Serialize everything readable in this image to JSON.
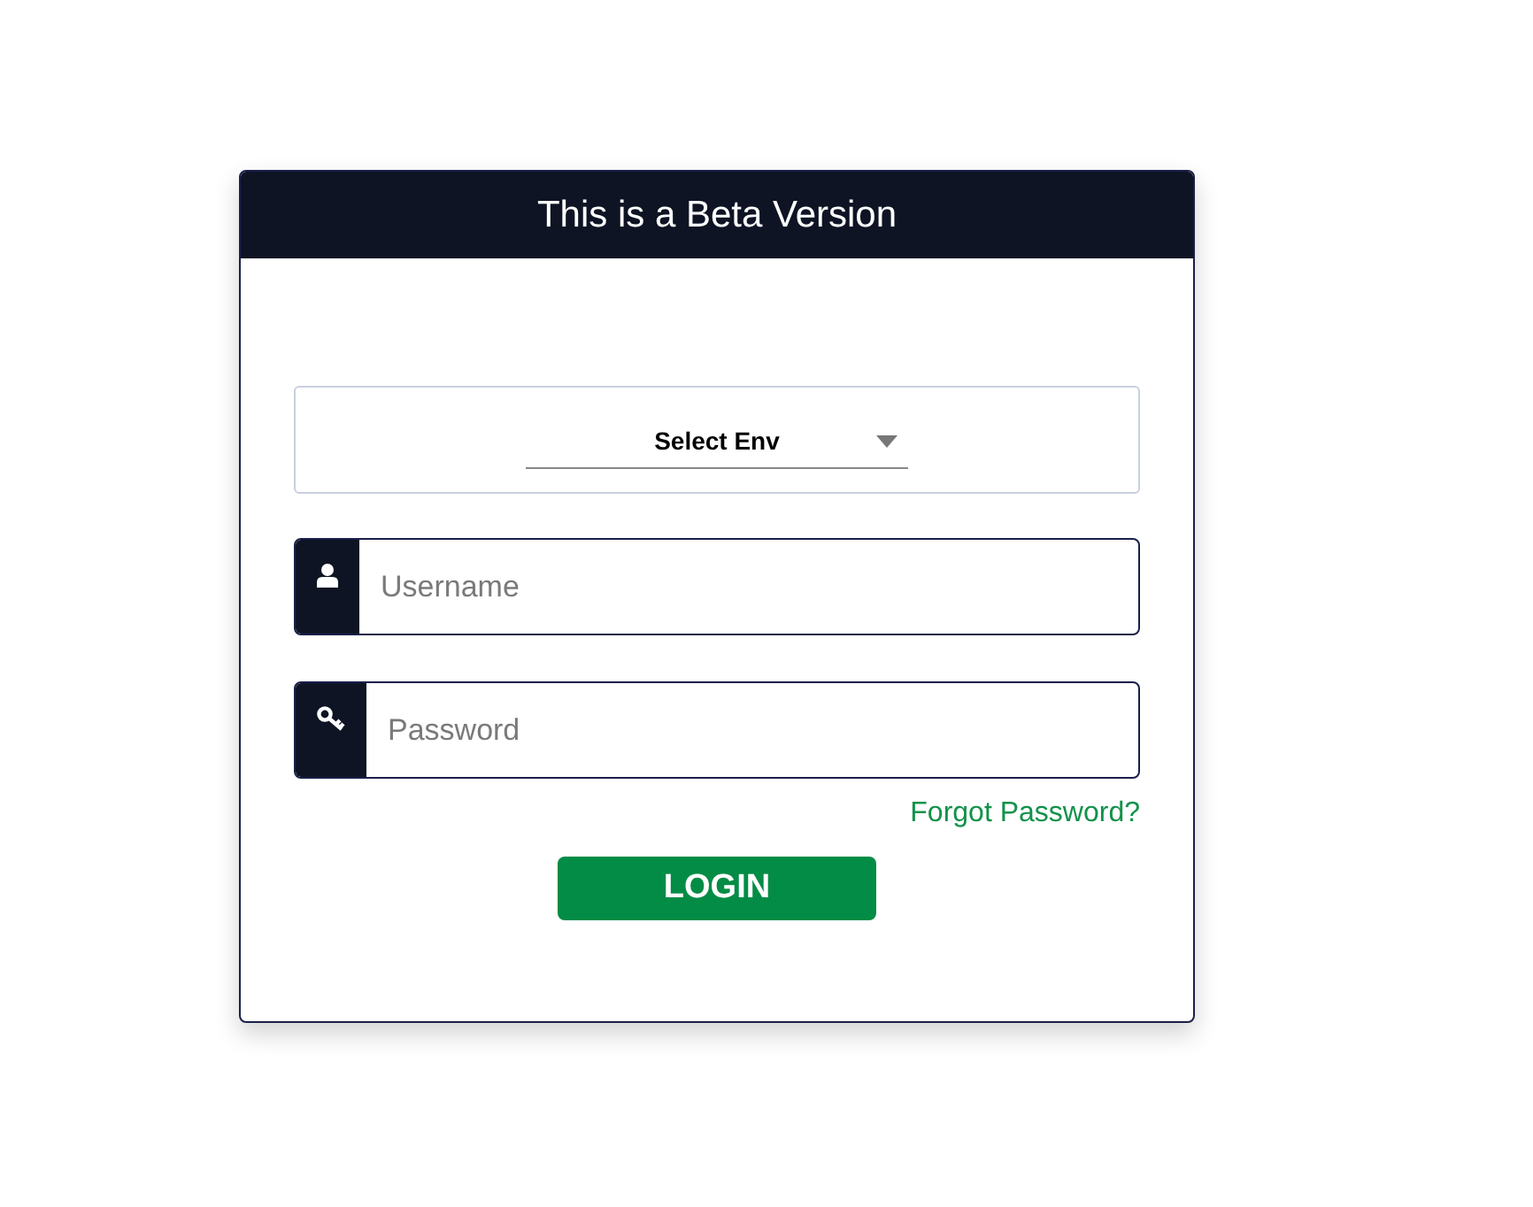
{
  "header": {
    "title": "This is a Beta Version"
  },
  "env_select": {
    "value": "Select Env"
  },
  "fields": [
    {
      "kind": "user",
      "placeholder": "Username"
    },
    {
      "kind": "key",
      "placeholder": "Password"
    }
  ],
  "forgot_link": "Forgot Password?",
  "login_button": "LOGIN"
}
